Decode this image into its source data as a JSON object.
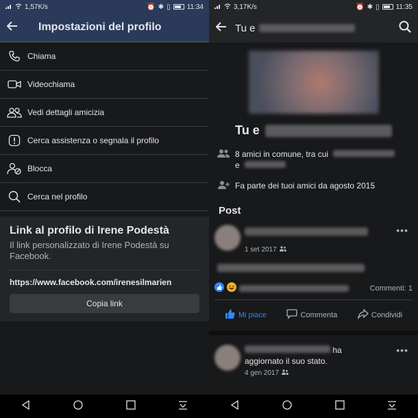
{
  "left": {
    "status": {
      "speed": "1,57K/s",
      "time": "11:34"
    },
    "header": {
      "title": "Impostazioni del profilo"
    },
    "menu": [
      {
        "label": "Chiama",
        "icon": "phone-icon"
      },
      {
        "label": "Videochiama",
        "icon": "video-icon"
      },
      {
        "label": "Vedi dettagli amicizia",
        "icon": "friends-icon"
      },
      {
        "label": "Cerca assistenza o segnala il profilo",
        "icon": "report-icon"
      },
      {
        "label": "Blocca",
        "icon": "block-user-icon"
      },
      {
        "label": "Cerca nel profilo",
        "icon": "search-icon"
      }
    ],
    "link_section": {
      "title": "Link al profilo di Irene Podestà",
      "description": "Il link personalizzato di Irene Podestà su Facebook.",
      "url": "https://www.facebook.com/irenesilmarien",
      "copy_label": "Copia link"
    }
  },
  "right": {
    "status": {
      "speed": "3,17K/s",
      "time": "11:35"
    },
    "header": {
      "title": "Tu e"
    },
    "profile_name": "Tu e",
    "mutual_friends_text": "8 amici in comune, tra cui",
    "mutual_friends_and": "e",
    "friends_since": "Fa parte dei tuoi amici da agosto 2015",
    "section_title": "Post",
    "post1": {
      "date": "1 set 2017",
      "comments": "Commenti: 1",
      "like": "Mi piace",
      "comment": "Commenta",
      "share": "Condividi"
    },
    "post2": {
      "text_suffix": "ha",
      "text_line2": "aggiornato il suo stato.",
      "date": "4 gen 2017"
    }
  },
  "colors": {
    "background": "#18191a",
    "surface": "#242526",
    "accent_blue": "#2d88ff",
    "left_header": "#2b3a5a"
  }
}
